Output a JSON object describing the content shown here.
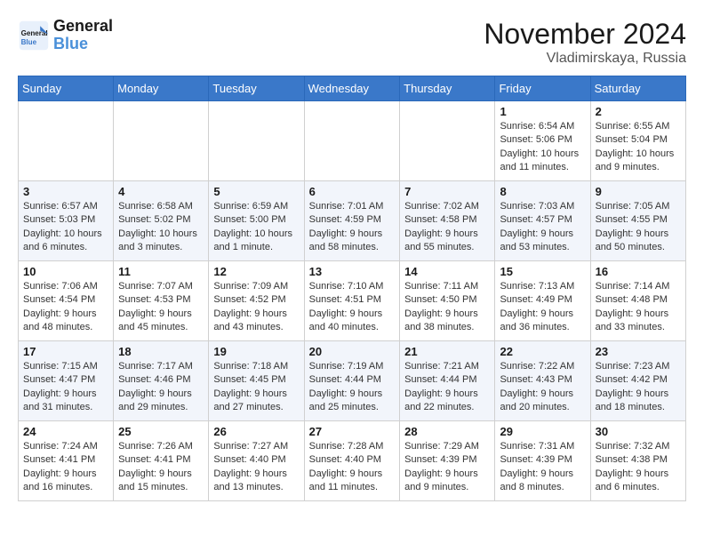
{
  "header": {
    "logo_line1": "General",
    "logo_line2": "Blue",
    "month": "November 2024",
    "location": "Vladimirskaya, Russia"
  },
  "weekdays": [
    "Sunday",
    "Monday",
    "Tuesday",
    "Wednesday",
    "Thursday",
    "Friday",
    "Saturday"
  ],
  "weeks": [
    [
      {
        "day": "",
        "info": ""
      },
      {
        "day": "",
        "info": ""
      },
      {
        "day": "",
        "info": ""
      },
      {
        "day": "",
        "info": ""
      },
      {
        "day": "",
        "info": ""
      },
      {
        "day": "1",
        "info": "Sunrise: 6:54 AM\nSunset: 5:06 PM\nDaylight: 10 hours and 11 minutes."
      },
      {
        "day": "2",
        "info": "Sunrise: 6:55 AM\nSunset: 5:04 PM\nDaylight: 10 hours and 9 minutes."
      }
    ],
    [
      {
        "day": "3",
        "info": "Sunrise: 6:57 AM\nSunset: 5:03 PM\nDaylight: 10 hours and 6 minutes."
      },
      {
        "day": "4",
        "info": "Sunrise: 6:58 AM\nSunset: 5:02 PM\nDaylight: 10 hours and 3 minutes."
      },
      {
        "day": "5",
        "info": "Sunrise: 6:59 AM\nSunset: 5:00 PM\nDaylight: 10 hours and 1 minute."
      },
      {
        "day": "6",
        "info": "Sunrise: 7:01 AM\nSunset: 4:59 PM\nDaylight: 9 hours and 58 minutes."
      },
      {
        "day": "7",
        "info": "Sunrise: 7:02 AM\nSunset: 4:58 PM\nDaylight: 9 hours and 55 minutes."
      },
      {
        "day": "8",
        "info": "Sunrise: 7:03 AM\nSunset: 4:57 PM\nDaylight: 9 hours and 53 minutes."
      },
      {
        "day": "9",
        "info": "Sunrise: 7:05 AM\nSunset: 4:55 PM\nDaylight: 9 hours and 50 minutes."
      }
    ],
    [
      {
        "day": "10",
        "info": "Sunrise: 7:06 AM\nSunset: 4:54 PM\nDaylight: 9 hours and 48 minutes."
      },
      {
        "day": "11",
        "info": "Sunrise: 7:07 AM\nSunset: 4:53 PM\nDaylight: 9 hours and 45 minutes."
      },
      {
        "day": "12",
        "info": "Sunrise: 7:09 AM\nSunset: 4:52 PM\nDaylight: 9 hours and 43 minutes."
      },
      {
        "day": "13",
        "info": "Sunrise: 7:10 AM\nSunset: 4:51 PM\nDaylight: 9 hours and 40 minutes."
      },
      {
        "day": "14",
        "info": "Sunrise: 7:11 AM\nSunset: 4:50 PM\nDaylight: 9 hours and 38 minutes."
      },
      {
        "day": "15",
        "info": "Sunrise: 7:13 AM\nSunset: 4:49 PM\nDaylight: 9 hours and 36 minutes."
      },
      {
        "day": "16",
        "info": "Sunrise: 7:14 AM\nSunset: 4:48 PM\nDaylight: 9 hours and 33 minutes."
      }
    ],
    [
      {
        "day": "17",
        "info": "Sunrise: 7:15 AM\nSunset: 4:47 PM\nDaylight: 9 hours and 31 minutes."
      },
      {
        "day": "18",
        "info": "Sunrise: 7:17 AM\nSunset: 4:46 PM\nDaylight: 9 hours and 29 minutes."
      },
      {
        "day": "19",
        "info": "Sunrise: 7:18 AM\nSunset: 4:45 PM\nDaylight: 9 hours and 27 minutes."
      },
      {
        "day": "20",
        "info": "Sunrise: 7:19 AM\nSunset: 4:44 PM\nDaylight: 9 hours and 25 minutes."
      },
      {
        "day": "21",
        "info": "Sunrise: 7:21 AM\nSunset: 4:44 PM\nDaylight: 9 hours and 22 minutes."
      },
      {
        "day": "22",
        "info": "Sunrise: 7:22 AM\nSunset: 4:43 PM\nDaylight: 9 hours and 20 minutes."
      },
      {
        "day": "23",
        "info": "Sunrise: 7:23 AM\nSunset: 4:42 PM\nDaylight: 9 hours and 18 minutes."
      }
    ],
    [
      {
        "day": "24",
        "info": "Sunrise: 7:24 AM\nSunset: 4:41 PM\nDaylight: 9 hours and 16 minutes."
      },
      {
        "day": "25",
        "info": "Sunrise: 7:26 AM\nSunset: 4:41 PM\nDaylight: 9 hours and 15 minutes."
      },
      {
        "day": "26",
        "info": "Sunrise: 7:27 AM\nSunset: 4:40 PM\nDaylight: 9 hours and 13 minutes."
      },
      {
        "day": "27",
        "info": "Sunrise: 7:28 AM\nSunset: 4:40 PM\nDaylight: 9 hours and 11 minutes."
      },
      {
        "day": "28",
        "info": "Sunrise: 7:29 AM\nSunset: 4:39 PM\nDaylight: 9 hours and 9 minutes."
      },
      {
        "day": "29",
        "info": "Sunrise: 7:31 AM\nSunset: 4:39 PM\nDaylight: 9 hours and 8 minutes."
      },
      {
        "day": "30",
        "info": "Sunrise: 7:32 AM\nSunset: 4:38 PM\nDaylight: 9 hours and 6 minutes."
      }
    ]
  ]
}
